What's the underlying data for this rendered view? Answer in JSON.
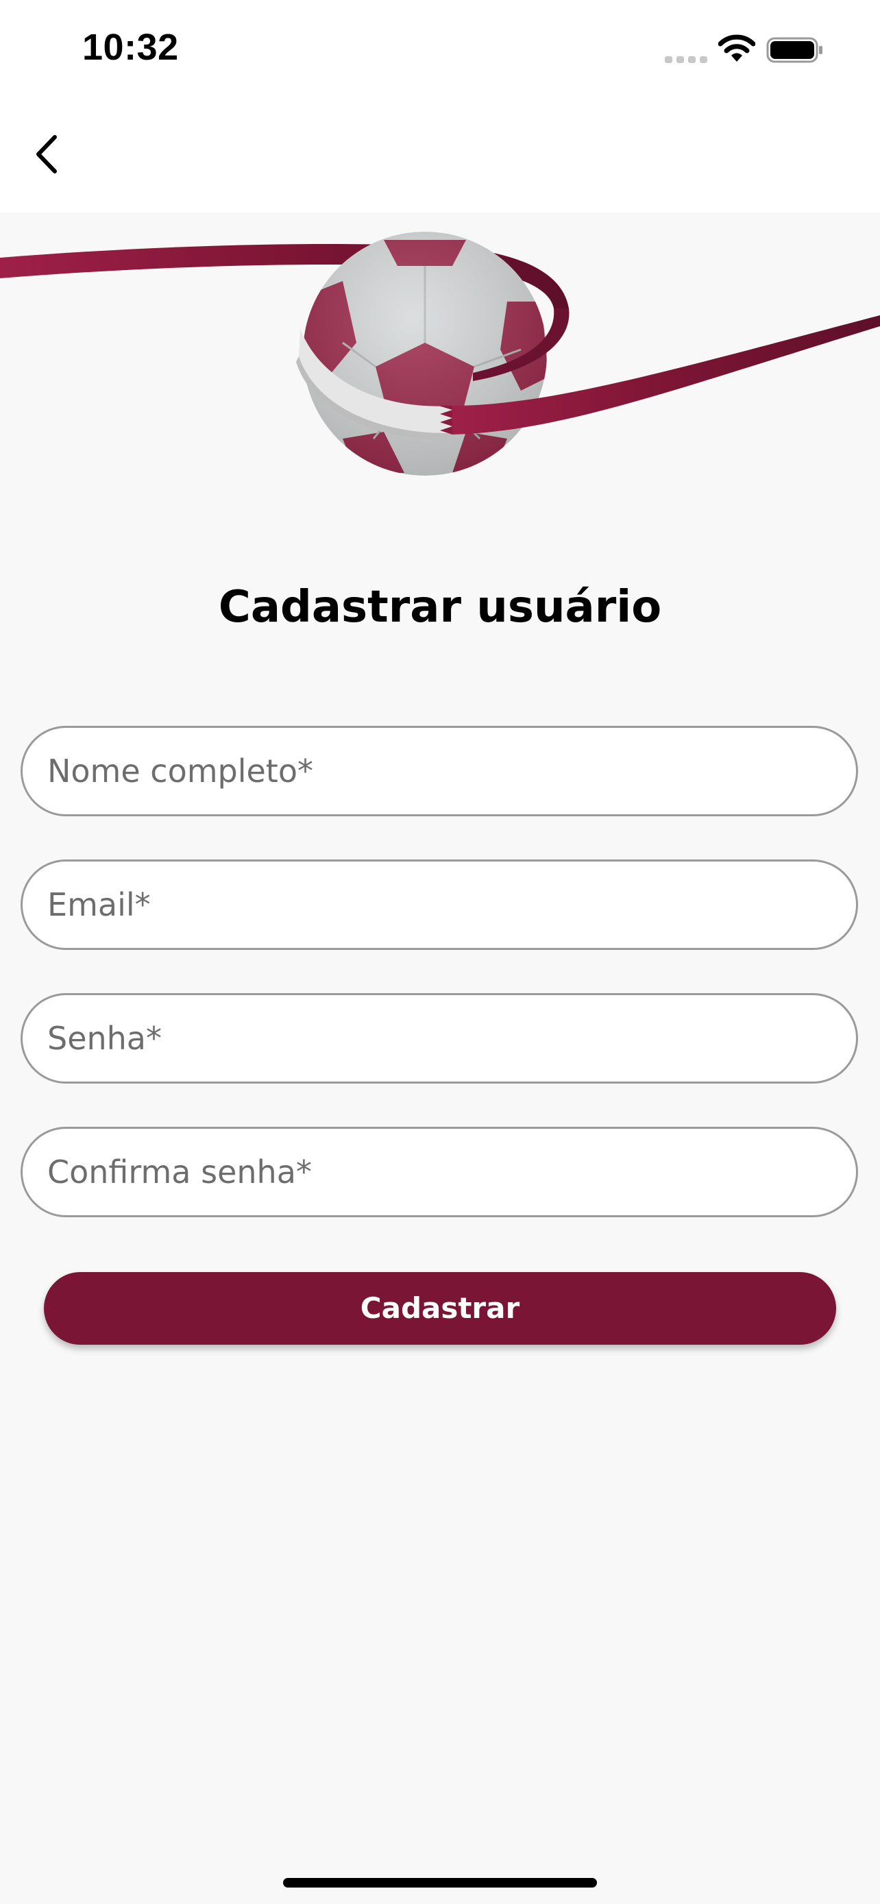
{
  "status_bar": {
    "time": "10:32",
    "icons": [
      "cellular-signal-icon",
      "wifi-icon",
      "battery-icon"
    ]
  },
  "nav": {
    "back_icon": "chevron-left-icon"
  },
  "hero": {
    "image": "soccer-ball-with-ribbon",
    "colors": {
      "ribbon": "#8a1a3f",
      "ribbon_dark": "#5e0f2a",
      "ball_patch": "#9e2a4c",
      "ball_panel": "#d9dcdc"
    }
  },
  "title": "Cadastrar usuário",
  "form": {
    "name_placeholder": "Nome completo*",
    "name_value": "",
    "email_placeholder": "Email*",
    "email_value": "",
    "password_placeholder": "Senha*",
    "password_value": "",
    "confirm_placeholder": "Confirma senha*",
    "confirm_value": ""
  },
  "submit_label": "Cadastrar",
  "colors": {
    "accent": "#7a1535",
    "background": "#f8f8f8",
    "field_border": "#9a9a9a"
  }
}
